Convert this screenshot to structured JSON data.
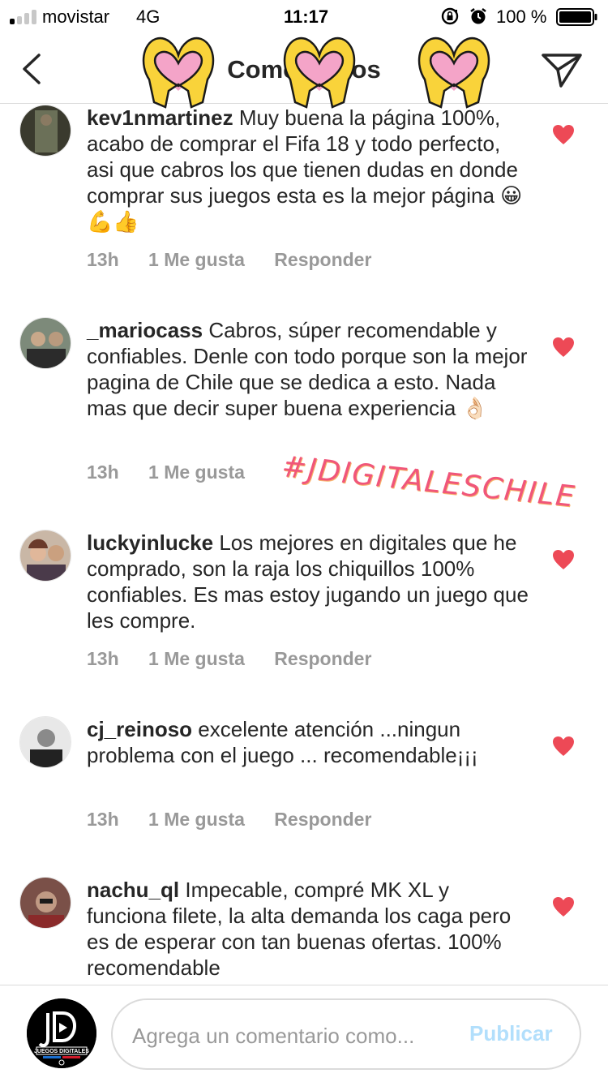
{
  "status_bar": {
    "carrier": "movistar",
    "network": "4G",
    "time": "11:17",
    "battery": "100 %",
    "icons": [
      "signal-icon",
      "lock-rotation-icon",
      "alarm-icon",
      "battery-icon"
    ]
  },
  "header": {
    "title": "Comentarios",
    "back_icon": "chevron-left-icon",
    "send_icon": "paper-plane-icon",
    "sticker": "heart-hands-emoji"
  },
  "comments": [
    {
      "username": "kev1nmartinez",
      "text": "Muy buena la página 100%, acabo de comprar el Fifa 18 y todo perfecto, asi que cabros los que tienen dudas en donde comprar sus juegos esta es la mejor página 😀💪👍",
      "time": "13h",
      "likes": "1 Me gusta",
      "reply": "Responder",
      "liked": true
    },
    {
      "username": "_mariocass",
      "text": "Cabros, súper recomendable y confiables. Denle con todo porque son la mejor pagina de Chile que se dedica a esto. Nada mas que decir super buena experiencia 👌🏻",
      "time": "13h",
      "likes": "1 Me gusta",
      "reply": "",
      "liked": true
    },
    {
      "username": "luckyinlucke",
      "text": "Los mejores en digitales que he comprado, son la raja los chiquillos 100% confiables. Es mas estoy jugando un juego que les compre.",
      "time": "13h",
      "likes": "1 Me gusta",
      "reply": "Responder",
      "liked": true
    },
    {
      "username": "cj_reinoso",
      "text": "excelente atención ...ningun problema con el juego ... recomendable¡¡¡",
      "time": "13h",
      "likes": "1 Me gusta",
      "reply": "Responder",
      "liked": true
    },
    {
      "username": "nachu_ql",
      "text": "Impecable, compré MK XL  y funciona filete, la alta demanda los caga pero es de esperar con tan buenas ofertas. 100% recomendable",
      "time": "",
      "likes": "",
      "reply": "",
      "liked": true
    }
  ],
  "hashtag_sticker": "#JDIGITALESCHILE",
  "composer": {
    "placeholder": "Agrega un comentario como...",
    "publish_label": "Publicar",
    "avatar_label": "JUEGOS DIGITALES"
  },
  "colors": {
    "like_red": "#ed4956",
    "meta_gray": "#999999",
    "publish_blue": "#b2dffc",
    "hashtag_pink": "#f0567a"
  }
}
